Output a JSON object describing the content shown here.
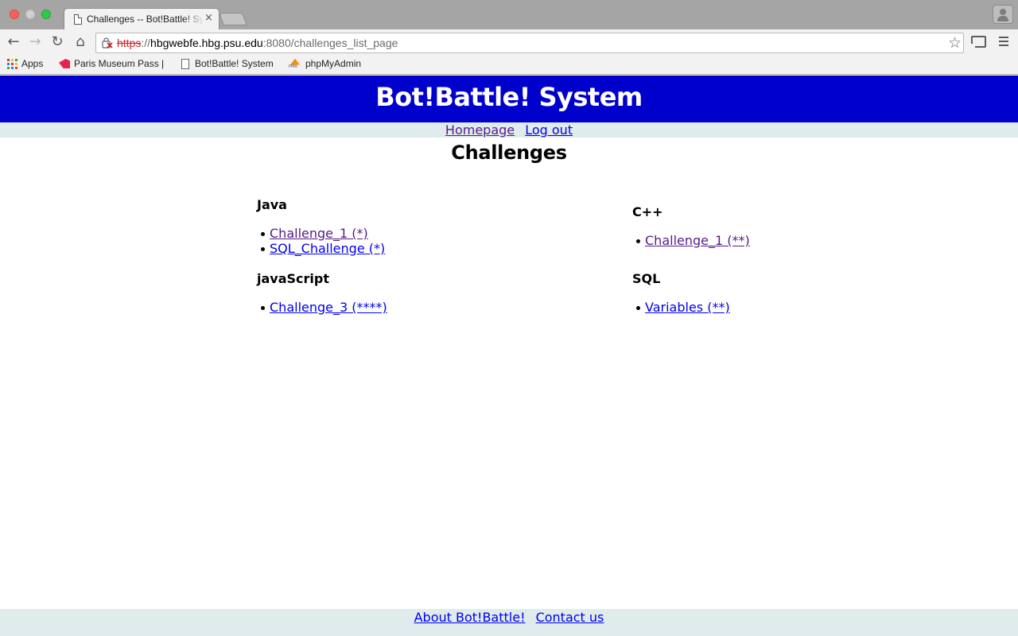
{
  "browser": {
    "tab_title": "Challenges -- Bot!Battle! System",
    "tab_close": "×",
    "url_scheme": "https",
    "url_sep": "://",
    "url_host": "hbgwebfe.hbg.psu.edu",
    "url_rest": ":8080/challenges_list_page",
    "bookmarks": [
      {
        "label": "Apps",
        "icon": "apps-grid-icon"
      },
      {
        "label": "Paris Museum Pass |",
        "icon": "paris-museum-icon"
      },
      {
        "label": "Bot!Battle! System",
        "icon": "document-icon"
      },
      {
        "label": "phpMyAdmin",
        "icon": "phpmyadmin-icon"
      }
    ]
  },
  "site": {
    "title": "Bot!Battle! System",
    "nav": {
      "homepage": "Homepage",
      "logout": "Log out"
    },
    "heading": "Challenges",
    "sections": {
      "java": {
        "title": "Java",
        "items": [
          "Challenge_1 (*)",
          "SQL_Challenge (*)"
        ]
      },
      "cpp": {
        "title": "C++",
        "items": [
          "Challenge_1 (**)"
        ]
      },
      "javascript": {
        "title": "javaScript",
        "items": [
          "Challenge_3 (****)"
        ]
      },
      "sql": {
        "title": "SQL",
        "items": [
          "Variables (**)"
        ]
      }
    },
    "footer": {
      "about": "About Bot!Battle!",
      "contact": "Contact us"
    }
  },
  "colors": {
    "header_bg": "#0000cd",
    "nav_bg": "#e0ebeb",
    "link": "#0000ee",
    "visited_link": "#551a8b"
  }
}
